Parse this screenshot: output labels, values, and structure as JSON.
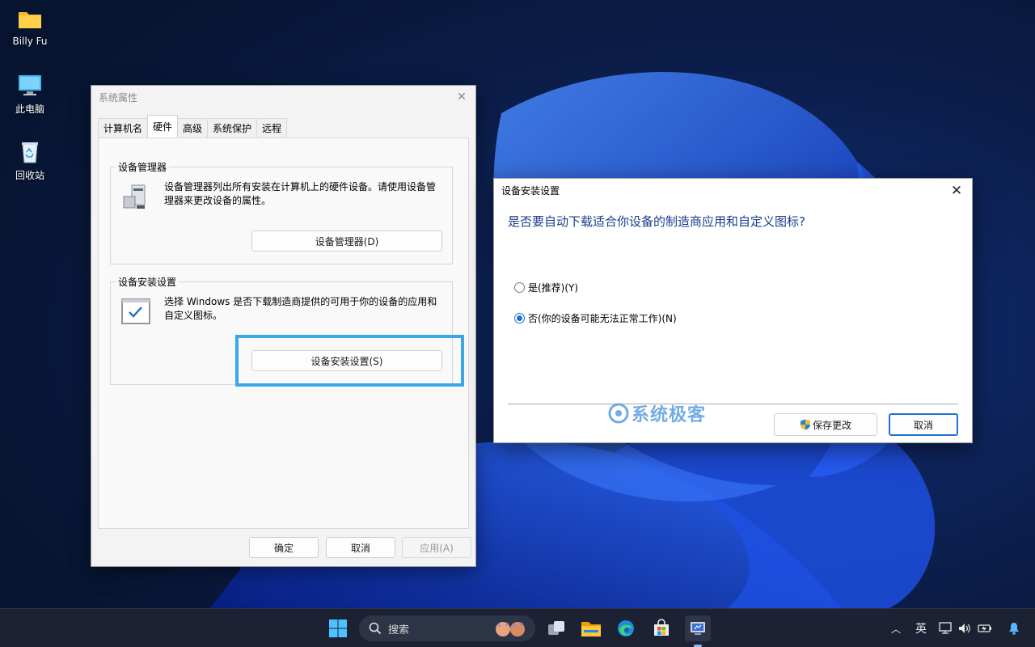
{
  "desktop": {
    "icons": [
      {
        "label": "Billy Fu",
        "icon": "folder-icon"
      },
      {
        "label": "此电脑",
        "icon": "computer-icon"
      },
      {
        "label": "回收站",
        "icon": "recycle-bin-icon"
      }
    ]
  },
  "system_properties": {
    "title": "系统属性",
    "tabs": [
      "计算机名",
      "硬件",
      "高级",
      "系统保护",
      "远程"
    ],
    "active_tab": "硬件",
    "device_manager": {
      "legend": "设备管理器",
      "description": "设备管理器列出所有安装在计算机上的硬件设备。请使用设备管理器来更改设备的属性。",
      "button": "设备管理器(D)"
    },
    "device_installation": {
      "legend": "设备安装设置",
      "description": "选择 Windows 是否下载制造商提供的可用于你的设备的应用和自定义图标。",
      "button": "设备安装设置(S)"
    },
    "footer": {
      "ok": "确定",
      "cancel": "取消",
      "apply": "应用(A)"
    }
  },
  "device_install_dialog": {
    "title": "设备安装设置",
    "question": "是否要自动下载适合你设备的制造商应用和自定义图标?",
    "options": [
      {
        "label": "是(推荐)(Y)",
        "checked": false
      },
      {
        "label": "否(你的设备可能无法正常工作)(N)",
        "checked": true
      }
    ],
    "save_button": "保存更改",
    "cancel_button": "取消",
    "watermark": "系统极客"
  },
  "taskbar": {
    "search_placeholder": "搜索",
    "ime": "英"
  },
  "colors": {
    "accent": "#1f6fd0",
    "highlight_frame": "#3aa7e8",
    "question_text": "#1a3c8c"
  }
}
